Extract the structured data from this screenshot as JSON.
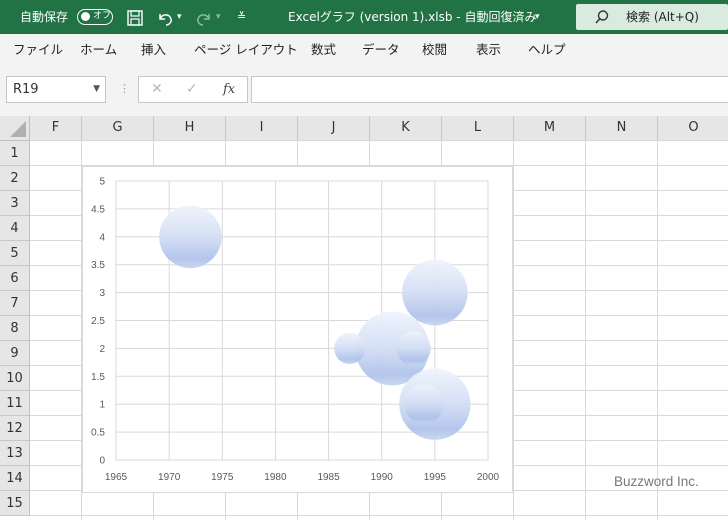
{
  "titlebar": {
    "autosave_label": "自動保存",
    "autosave_state": "オフ",
    "file_title": "Excelグラフ (version 1).xlsb  -  自動回復済み",
    "search_label": "検索 (Alt+Q)"
  },
  "ribbon_tabs": [
    "ファイル",
    "ホーム",
    "挿入",
    "ページ レイアウト",
    "数式",
    "データ",
    "校閲",
    "表示",
    "ヘルプ"
  ],
  "formula_bar": {
    "name_box": "R19",
    "fx_label": "fx",
    "formula": ""
  },
  "columns": [
    "F",
    "G",
    "H",
    "I",
    "J",
    "K",
    "L",
    "M",
    "N",
    "O"
  ],
  "rows": [
    "1",
    "2",
    "3",
    "4",
    "5",
    "6",
    "7",
    "8",
    "9",
    "10",
    "11",
    "12",
    "13",
    "14",
    "15"
  ],
  "chart_data": {
    "type": "bubble",
    "x_ticks": [
      "1965",
      "1970",
      "1975",
      "1980",
      "1985",
      "1990",
      "1995",
      "2000"
    ],
    "y_ticks": [
      "0",
      "0.5",
      "1",
      "1.5",
      "2",
      "2.5",
      "3",
      "3.5",
      "4",
      "4.5",
      "5"
    ],
    "xlim": [
      1965,
      2000
    ],
    "ylim": [
      0,
      5
    ],
    "grid": true,
    "series": [
      {
        "color": "#a9bde7",
        "points": [
          {
            "x": 1972,
            "y": 4,
            "size": 10
          },
          {
            "x": 1987,
            "y": 2,
            "size": 2.5
          },
          {
            "x": 1991,
            "y": 2,
            "size": 14
          },
          {
            "x": 1993,
            "y": 2,
            "size": 3
          },
          {
            "x": 1995,
            "y": 3,
            "size": 11
          },
          {
            "x": 1995,
            "y": 1,
            "size": 13
          },
          {
            "x": 1994,
            "y": 1,
            "size": 4
          }
        ]
      }
    ]
  },
  "watermark": "Buzzword Inc."
}
